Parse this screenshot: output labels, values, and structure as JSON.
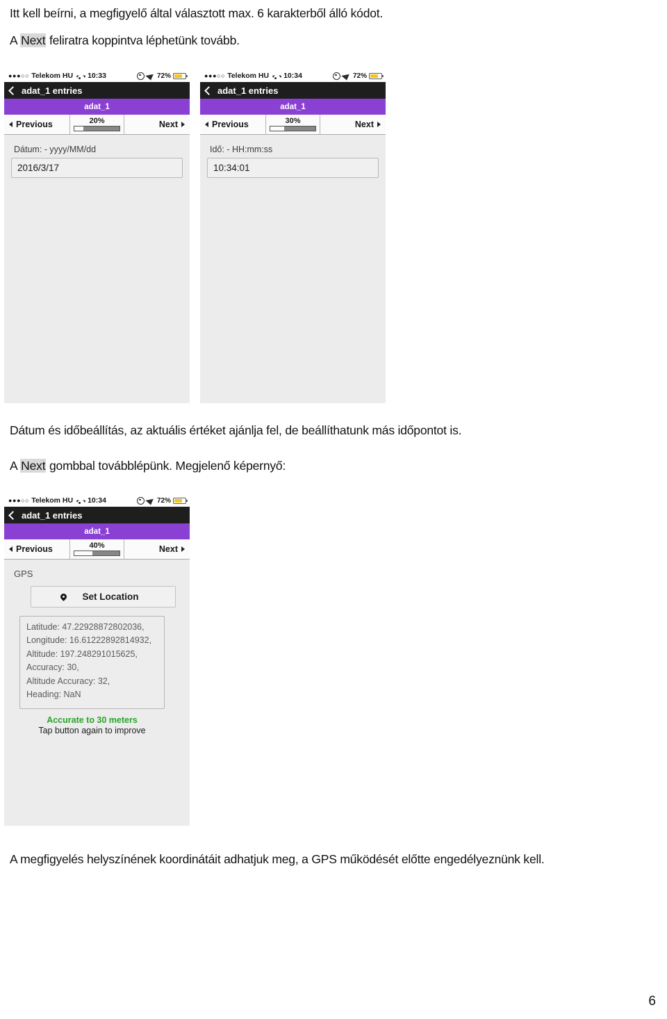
{
  "document": {
    "paragraphs": [
      {
        "before": "Itt kell beírni, a megfigyelő által választott max. 6 karakterből álló kódot.",
        "highlight": "",
        "after": ""
      },
      {
        "before": "A ",
        "highlight": "Next",
        "after": " feliratra koppintva léphetünk tovább."
      },
      {
        "before": "Dátum és időbeállítás, az aktuális értéket ajánlja fel, de beállíthatunk más időpontot is.",
        "highlight": "",
        "after": ""
      },
      {
        "before": "A ",
        "highlight": "Next",
        "after": " gombbal továbblépünk. Megjelenő képernyő:"
      },
      {
        "before": "A megfigyelés helyszínének koordinátáit adhatjuk meg, a GPS működését előtte engedélyeznünk kell.",
        "highlight": "",
        "after": ""
      }
    ],
    "page_number": "6"
  },
  "colors": {
    "purple_titlebar": "#8B40D4",
    "navbar_black": "#1e1e1e",
    "battery_yellow": "#f5c518",
    "accuracy_green": "#2aa32a",
    "screen_background": "#ececec",
    "highlight_gray": "#d9d9d9"
  },
  "screenshots": [
    {
      "status": {
        "signal_dots": "●●●○○",
        "carrier": "Telekom HU",
        "wifi_icon": "wifi-icon",
        "time": "10:33",
        "lock_icon": "rotation-lock-icon",
        "location_icon": "location-arrow-icon",
        "battery_percent": "72%",
        "battery_fill": 72
      },
      "nav": {
        "back_icon": "chevron-left-icon",
        "title": "adat_1 entries"
      },
      "title_bar": "adat_1",
      "toolbar": {
        "previous_label": "Previous",
        "next_label": "Next",
        "percent_label": "20%",
        "percent_value": 20
      },
      "field": {
        "label": "Dátum: - yyyy/MM/dd",
        "value": "2016/3/17"
      }
    },
    {
      "status": {
        "signal_dots": "●●●○○",
        "carrier": "Telekom HU",
        "wifi_icon": "wifi-icon",
        "time": "10:34",
        "lock_icon": "rotation-lock-icon",
        "location_icon": "location-arrow-icon",
        "battery_percent": "72%",
        "battery_fill": 72
      },
      "nav": {
        "back_icon": "chevron-left-icon",
        "title": "adat_1 entries"
      },
      "title_bar": "adat_1",
      "toolbar": {
        "previous_label": "Previous",
        "next_label": "Next",
        "percent_label": "30%",
        "percent_value": 30
      },
      "field": {
        "label": "Idő: - HH:mm:ss",
        "value": "10:34:01"
      }
    },
    {
      "status": {
        "signal_dots": "●●●○○",
        "carrier": "Telekom HU",
        "wifi_icon": "wifi-icon",
        "time": "10:34",
        "lock_icon": "rotation-lock-icon",
        "location_icon": "location-arrow-icon",
        "battery_percent": "72%",
        "battery_fill": 72
      },
      "nav": {
        "back_icon": "chevron-left-icon",
        "title": "adat_1 entries"
      },
      "title_bar": "adat_1",
      "toolbar": {
        "previous_label": "Previous",
        "next_label": "Next",
        "percent_label": "40%",
        "percent_value": 40
      },
      "gps": {
        "section_label": "GPS",
        "button_label": "Set Location",
        "button_icon": "map-pin-icon",
        "readout": [
          "Latitude: 47.22928872802036,",
          "Longitude: 16.61222892814932,",
          "Altitude: 197.248291015625,",
          "Accuracy: 30,",
          "Altitude Accuracy: 32,",
          "Heading: NaN"
        ],
        "accuracy_line": "Accurate to 30 meters",
        "accuracy_sub": "Tap button again to improve"
      }
    }
  ]
}
